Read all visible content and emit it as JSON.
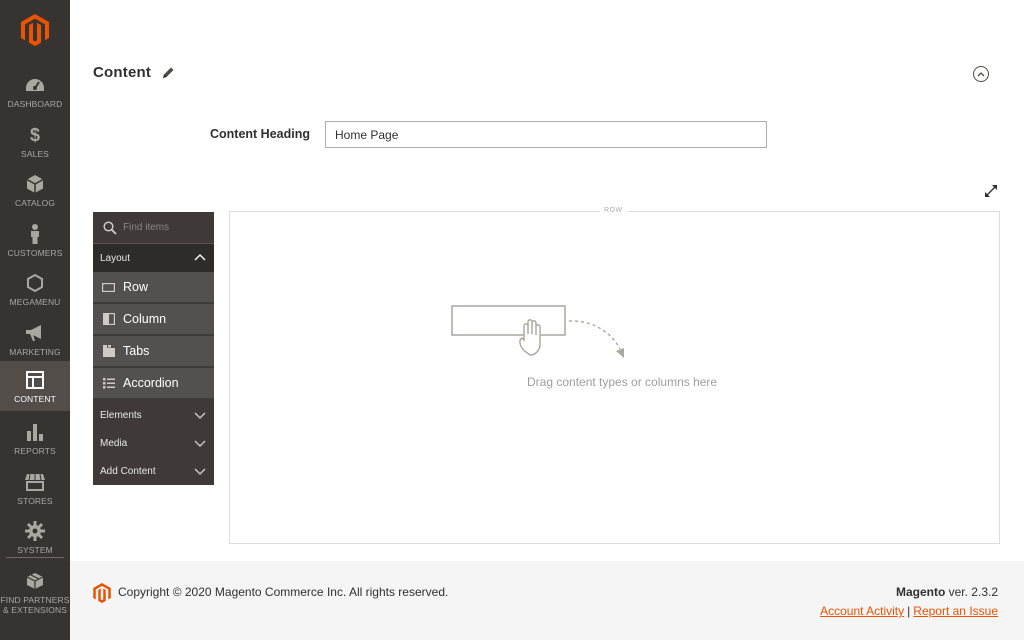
{
  "colors": {
    "brand": "#eb5202",
    "menu_bg": "#373330",
    "menu_active_bg": "#524d49",
    "panel_bg": "#3f3a37",
    "panel_item_bg": "#545050"
  },
  "menu": {
    "items": [
      {
        "label": "DASHBOARD",
        "icon": "dashboard-icon"
      },
      {
        "label": "SALES",
        "icon": "dollar-icon"
      },
      {
        "label": "CATALOG",
        "icon": "box-icon"
      },
      {
        "label": "CUSTOMERS",
        "icon": "person-icon"
      },
      {
        "label": "MEGAMENU",
        "icon": "hexagon-icon"
      },
      {
        "label": "MARKETING",
        "icon": "megaphone-icon"
      },
      {
        "label": "CONTENT",
        "icon": "layout-icon",
        "active": true
      },
      {
        "label": "REPORTS",
        "icon": "bar-chart-icon"
      },
      {
        "label": "STORES",
        "icon": "store-icon"
      },
      {
        "label": "SYSTEM",
        "icon": "gear-icon"
      }
    ],
    "partners_line1": "FIND PARTNERS",
    "partners_line2": "& EXTENSIONS"
  },
  "section": {
    "title": "Content",
    "heading_label": "Content Heading",
    "heading_value": "Home Page"
  },
  "panel": {
    "search_placeholder": "Find items",
    "groups": [
      {
        "label": "Layout",
        "open": true
      },
      {
        "label": "Elements",
        "open": false
      },
      {
        "label": "Media",
        "open": false
      },
      {
        "label": "Add Content",
        "open": false
      }
    ],
    "layout_items": [
      {
        "label": "Row",
        "icon": "row-icon"
      },
      {
        "label": "Column",
        "icon": "column-icon"
      },
      {
        "label": "Tabs",
        "icon": "tabs-icon"
      },
      {
        "label": "Accordion",
        "icon": "accordion-icon"
      }
    ]
  },
  "stage": {
    "row_label": "ROW",
    "drop_text": "Drag content types or columns here"
  },
  "footer": {
    "copyright": "Copyright © 2020 Magento Commerce Inc. All rights reserved.",
    "brand": "Magento",
    "version": " ver. 2.3.2",
    "link_activity": "Account Activity",
    "link_issue": "Report an Issue",
    "separator": "|"
  }
}
